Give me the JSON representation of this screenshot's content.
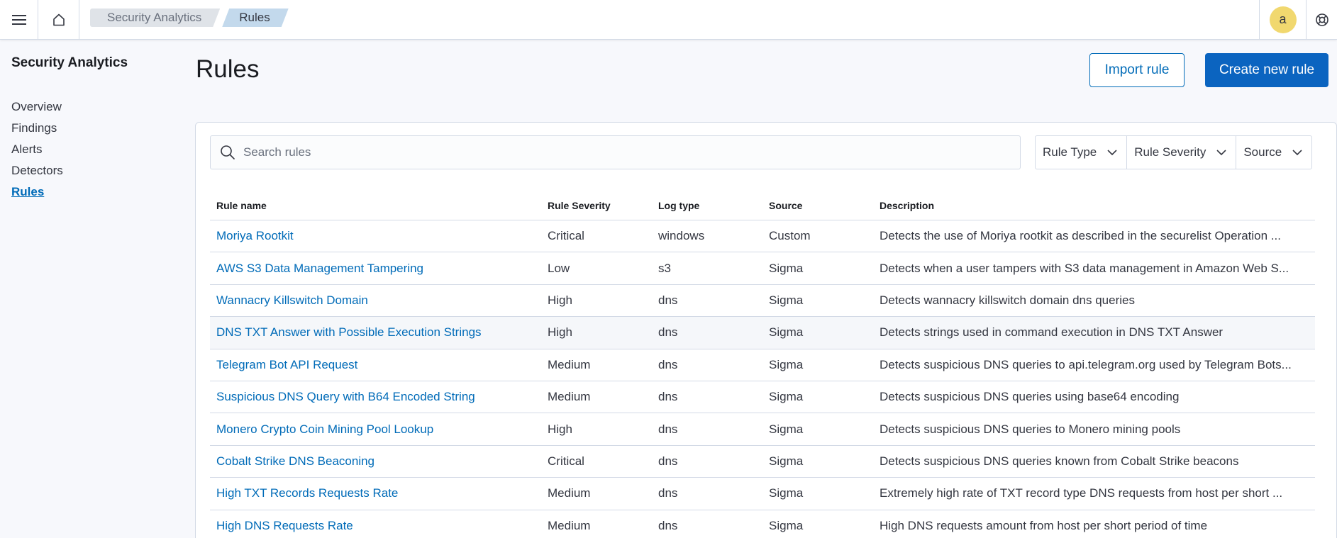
{
  "header": {
    "breadcrumbs": [
      "Security Analytics",
      "Rules"
    ],
    "avatar_initial": "a"
  },
  "sidebar": {
    "title": "Security Analytics",
    "items": [
      {
        "label": "Overview",
        "active": false
      },
      {
        "label": "Findings",
        "active": false
      },
      {
        "label": "Alerts",
        "active": false
      },
      {
        "label": "Detectors",
        "active": false
      },
      {
        "label": "Rules",
        "active": true
      }
    ]
  },
  "main": {
    "title": "Rules",
    "import_label": "Import rule",
    "create_label": "Create new rule",
    "search_placeholder": "Search rules",
    "filters": [
      "Rule Type",
      "Rule Severity",
      "Source"
    ]
  },
  "table": {
    "columns": [
      "Rule name",
      "Rule Severity",
      "Log type",
      "Source",
      "Description"
    ],
    "rows": [
      [
        "Moriya Rootkit",
        "Critical",
        "windows",
        "Custom",
        "Detects the use of Moriya rootkit as described in the securelist Operation ..."
      ],
      [
        "AWS S3 Data Management Tampering",
        "Low",
        "s3",
        "Sigma",
        "Detects when a user tampers with S3 data management in Amazon Web S..."
      ],
      [
        "Wannacry Killswitch Domain",
        "High",
        "dns",
        "Sigma",
        "Detects wannacry killswitch domain dns queries"
      ],
      [
        "DNS TXT Answer with Possible Execution Strings",
        "High",
        "dns",
        "Sigma",
        "Detects strings used in command execution in DNS TXT Answer"
      ],
      [
        "Telegram Bot API Request",
        "Medium",
        "dns",
        "Sigma",
        "Detects suspicious DNS queries to api.telegram.org used by Telegram Bots..."
      ],
      [
        "Suspicious DNS Query with B64 Encoded String",
        "Medium",
        "dns",
        "Sigma",
        "Detects suspicious DNS queries using base64 encoding"
      ],
      [
        "Monero Crypto Coin Mining Pool Lookup",
        "High",
        "dns",
        "Sigma",
        "Detects suspicious DNS queries to Monero mining pools"
      ],
      [
        "Cobalt Strike DNS Beaconing",
        "Critical",
        "dns",
        "Sigma",
        "Detects suspicious DNS queries known from Cobalt Strike beacons"
      ],
      [
        "High TXT Records Requests Rate",
        "Medium",
        "dns",
        "Sigma",
        "Extremely high rate of TXT record type DNS requests from host per short ..."
      ],
      [
        "High DNS Requests Rate",
        "Medium",
        "dns",
        "Sigma",
        "High DNS requests amount from host per short period of time"
      ]
    ]
  }
}
